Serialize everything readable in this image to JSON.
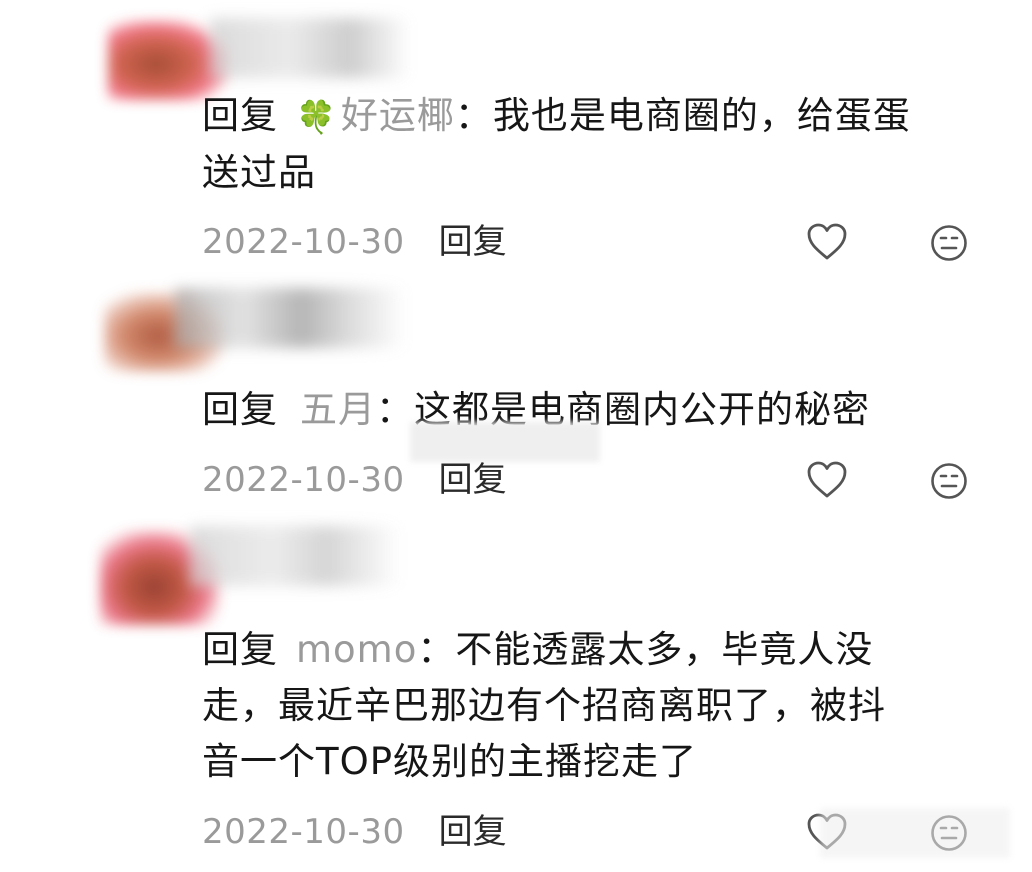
{
  "comments": [
    {
      "reply_label": "回复",
      "target_user": "好运椰",
      "target_emoji": "🍀",
      "text_line1": "：我也是电商圈的，给蛋蛋",
      "text_line2": "送过品",
      "date": "2022-10-30",
      "reply_button": "回复"
    },
    {
      "reply_label": "回复",
      "target_user": "五月",
      "text_line1": "：这都是电商圈内公开的秘密",
      "date": "2022-10-30",
      "reply_button": "回复"
    },
    {
      "reply_label": "回复",
      "target_user": "momo",
      "text_line1": "：不能透露太多，毕竟人没",
      "text_line2": "走，最近辛巴那边有个招商离职了，被抖",
      "text_line3": "音一个TOP级别的主播挖走了",
      "date": "2022-10-30",
      "reply_button": "回复"
    }
  ],
  "colors": {
    "text": "#161616",
    "muted": "#9a9a9a",
    "icon": "#555555",
    "avatar_red": "#b8412f",
    "avatar_pink": "#f05a7a"
  },
  "icons": [
    "heart-icon",
    "neutral-face-icon",
    "clover-emoji"
  ]
}
